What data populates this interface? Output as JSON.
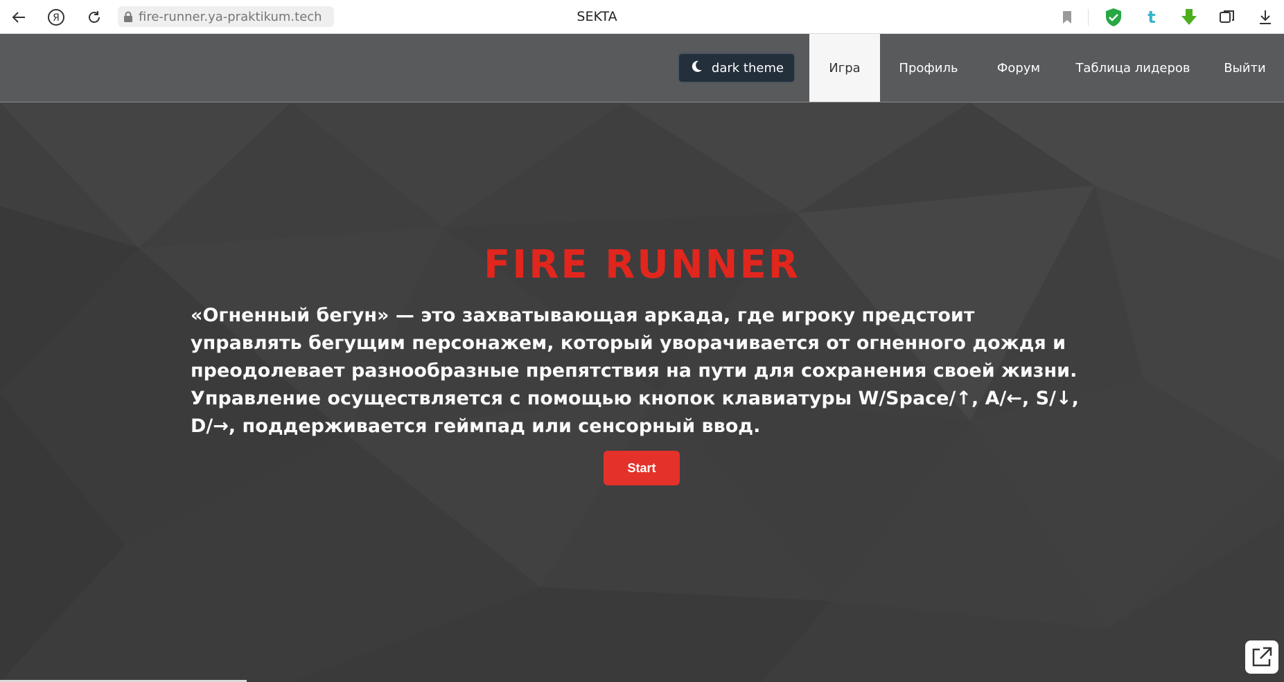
{
  "browser": {
    "url": "fire-runner.ya-praktikum.tech",
    "tab_title": "SEKTA",
    "icons": [
      "back-icon",
      "yandex-icon",
      "reload-icon",
      "lock-icon",
      "bookmark-icon",
      "shield-icon",
      "tumblr-icon",
      "download-arrow-icon",
      "extensions-icon",
      "downloads-icon"
    ]
  },
  "header": {
    "theme_button": "dark theme",
    "nav": [
      {
        "label": "Игра",
        "active": true
      },
      {
        "label": "Профиль",
        "active": false
      },
      {
        "label": "Форум",
        "active": false
      },
      {
        "label": "Таблица лидеров",
        "active": false
      },
      {
        "label": "Выйти",
        "active": false
      }
    ]
  },
  "main": {
    "title": "FIRE RUNNER",
    "description": "«Огненный бегун» — это захватывающая аркада, где игроку предстоит управлять бегущим персонажем, который уворачивается от огненного дождя и преодолевает разнообразные препятствия на пути для сохранения своей жизни. Управление осуществляется с помощью кнопок клавиатуры W/Space/↑, A/←, S/↓, D/→, поддерживается геймпад или сенсорный ввод.",
    "start_button": "Start"
  },
  "colors": {
    "accent": "#e1261d",
    "button": "#e4322a",
    "header_bg": "#595a5c",
    "theme_button_bg": "#232f3a",
    "page_bg": "#3f3f40"
  }
}
